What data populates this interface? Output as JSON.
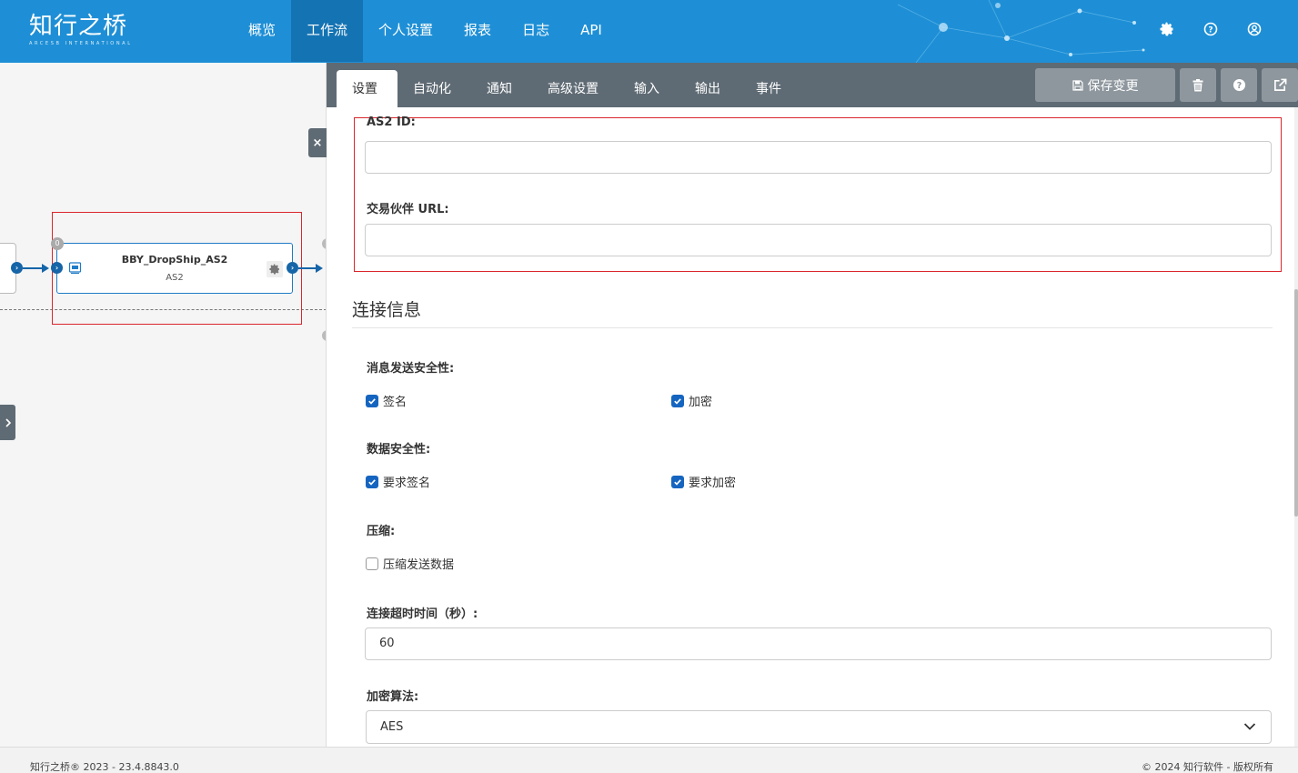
{
  "app": {
    "logo_cn": "知行之桥",
    "logo_en": "ARCESB INTERNATIONAL"
  },
  "nav": {
    "items": [
      {
        "label": "概览"
      },
      {
        "label": "工作流"
      },
      {
        "label": "个人设置"
      },
      {
        "label": "报表"
      },
      {
        "label": "日志"
      },
      {
        "label": "API"
      }
    ],
    "active_index": 1,
    "icons": [
      "gear-icon",
      "help-icon",
      "user-icon"
    ]
  },
  "canvas": {
    "node": {
      "title": "BBY_DropShip_AS2",
      "subtitle": "AS2",
      "badge": "0"
    }
  },
  "panel": {
    "tabs": [
      {
        "label": "设置"
      },
      {
        "label": "自动化"
      },
      {
        "label": "通知"
      },
      {
        "label": "高级设置"
      },
      {
        "label": "输入"
      },
      {
        "label": "输出"
      },
      {
        "label": "事件"
      }
    ],
    "active_tab": 0,
    "save_label": "保存变更",
    "form": {
      "as2_id_label": "AS2 ID:",
      "as2_id_value": "",
      "partner_url_label": "交易伙伴 URL:",
      "partner_url_value": "",
      "section_title": "连接信息",
      "msg_security_label": "消息发送安全性:",
      "sign_label": "签名",
      "sign_checked": true,
      "encrypt_label": "加密",
      "encrypt_checked": true,
      "data_security_label": "数据安全性:",
      "require_sign_label": "要求签名",
      "require_sign_checked": true,
      "require_encrypt_label": "要求加密",
      "require_encrypt_checked": true,
      "compress_label": "压缩:",
      "compress_send_label": "压缩发送数据",
      "compress_send_checked": false,
      "timeout_label": "连接超时时间（秒）:",
      "timeout_value": "60",
      "enc_algo_label": "加密算法:",
      "enc_algo_value": "AES"
    }
  },
  "footer": {
    "left": "知行之桥® 2023 - 23.4.8843.0",
    "right": "© 2024 知行软件 - 版权所有"
  },
  "colors": {
    "header_bg": "#1e8fd6",
    "nav_active_bg": "#1473b3",
    "tabbar_bg": "#5f6b74",
    "accent": "#1565c0",
    "highlight_red": "#d9262c"
  }
}
